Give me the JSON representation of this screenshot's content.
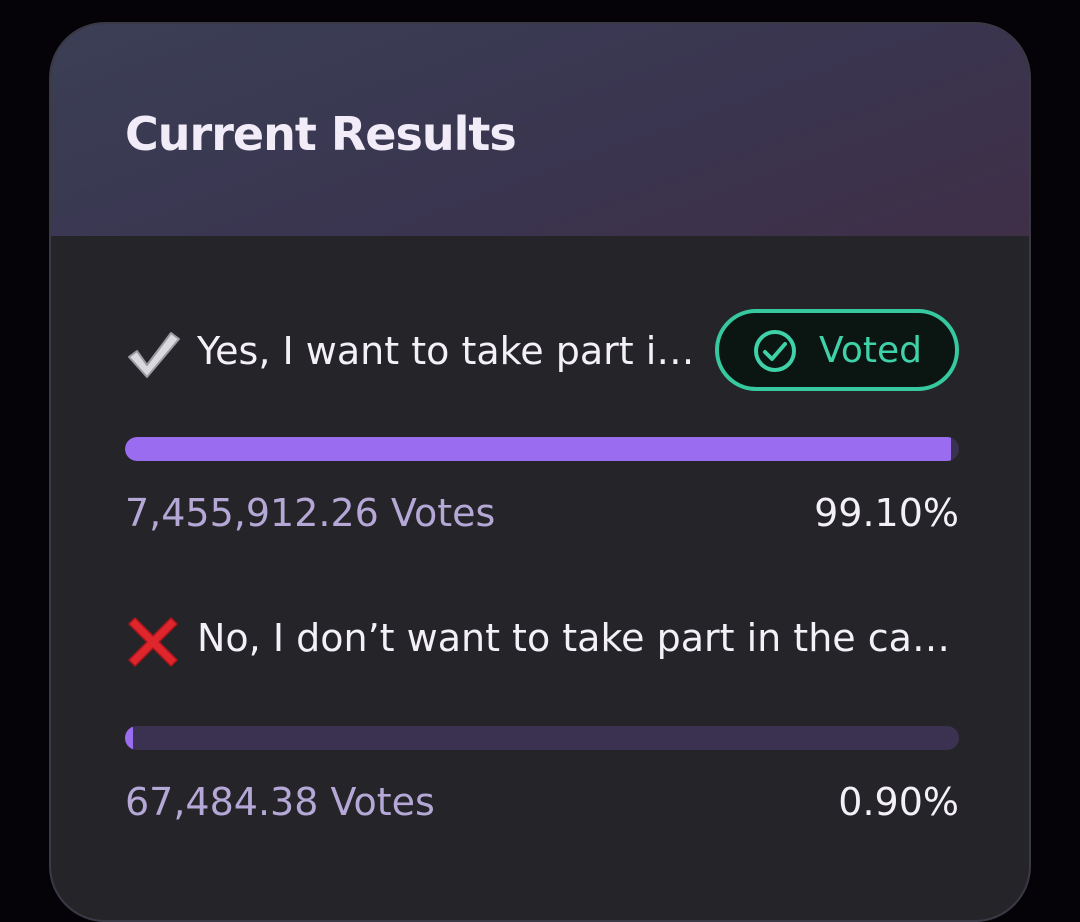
{
  "card": {
    "title": "Current Results"
  },
  "options": [
    {
      "emoji_icon": "check-mark-icon",
      "label": "Yes, I want to take part in the campaign",
      "voted": true,
      "voted_label": "Voted",
      "votes": "7,455,912.26 Votes",
      "percent": "99.10%",
      "fraction": 0.991,
      "bar_color": "#9a6cf0"
    },
    {
      "emoji_icon": "cross-mark-icon",
      "label": "No, I don’t want to take part in the campaign",
      "voted": false,
      "votes": "67,484.38 Votes",
      "percent": "0.90%",
      "fraction": 0.009,
      "bar_color": "#9a6cf0"
    }
  ],
  "colors": {
    "accent": "#9a6cf0",
    "voted_green": "#36c9a0",
    "votes_muted": "#b5a8d6"
  }
}
